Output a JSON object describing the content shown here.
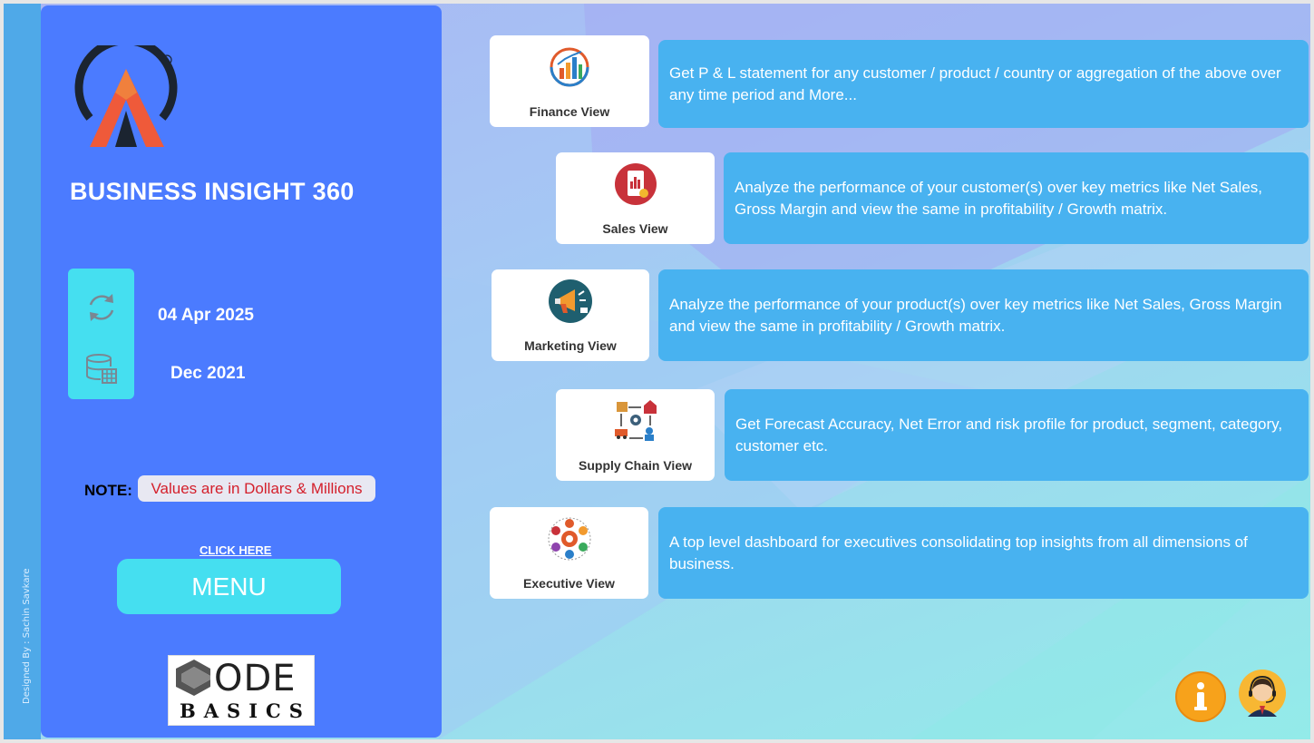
{
  "sidebar": {
    "designed_by": "Designed By : Sachin Savkare",
    "title": "BUSINESS INSIGHT 360",
    "refresh_date": "04 Apr 2025",
    "data_date": "Dec 2021",
    "note_label": "NOTE:",
    "note_value": "Values are in Dollars & Millions",
    "click_here": "CLICK HERE",
    "menu_label": "MENU",
    "codebasics_top": "ODE",
    "codebasics_bottom": "BASICS"
  },
  "views": [
    {
      "label": "Finance View",
      "icon": "finance-chart-icon",
      "description": "Get P & L statement for any customer / product / country or aggregation of the above over any time period and More..."
    },
    {
      "label": "Sales View",
      "icon": "sales-phone-icon",
      "description": "Analyze the performance of your customer(s) over key metrics like Net Sales, Gross Margin and view the same in profitability / Growth matrix."
    },
    {
      "label": "Marketing View",
      "icon": "megaphone-icon",
      "description": "Analyze the performance of your product(s) over key metrics like Net Sales, Gross Margin and view the same in profitability / Growth matrix."
    },
    {
      "label": "Supply Chain View",
      "icon": "supply-chain-icon",
      "description": "Get Forecast Accuracy, Net Error and risk profile for product, segment, category, customer etc."
    },
    {
      "label": "Executive View",
      "icon": "executive-gear-icon",
      "description": "A top level dashboard for executives consolidating top insights from all dimensions of business."
    }
  ],
  "colors": {
    "panel": "#4b7bff",
    "accent_cyan": "#45dff0",
    "description_box": "#48b2f0",
    "note_text": "#d41f2b",
    "info_button": "#f7a21b"
  },
  "icons": [
    "refresh-icon",
    "database-table-icon",
    "info-icon",
    "support-agent-icon",
    "atliq-logo"
  ]
}
